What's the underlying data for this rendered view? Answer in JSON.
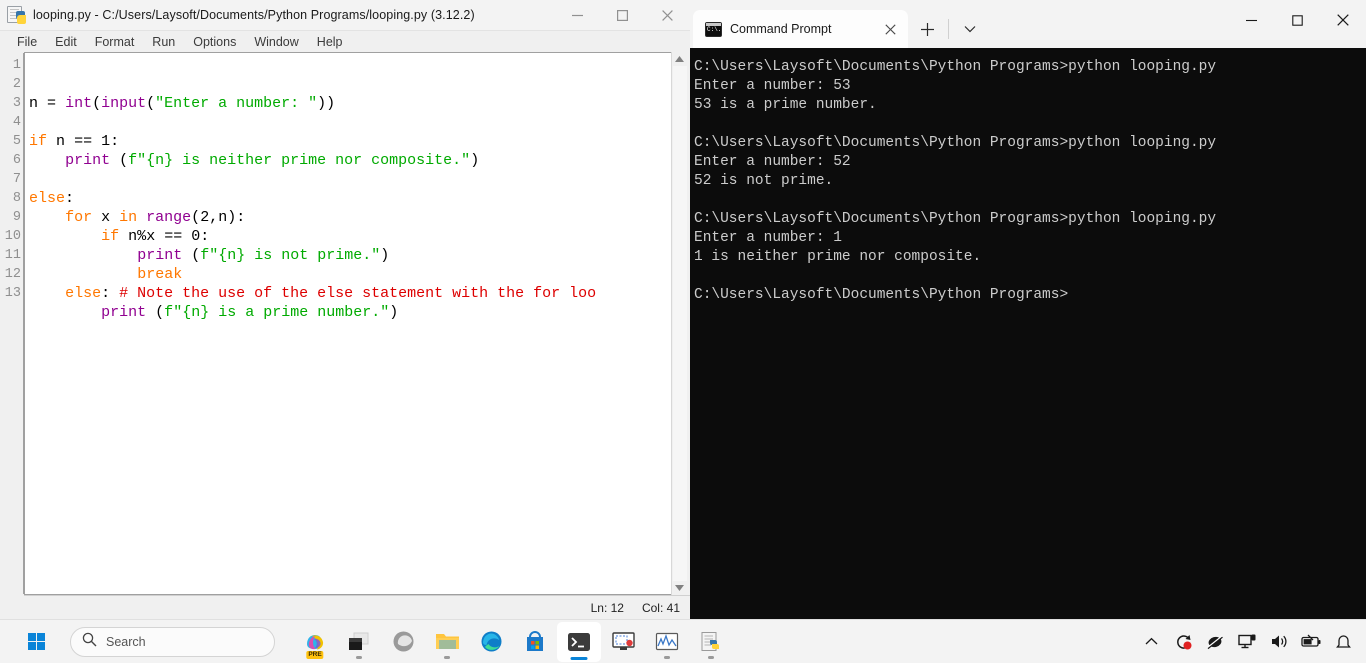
{
  "idle": {
    "window_icon": "python-file-icon",
    "title": "looping.py - C:/Users/Laysoft/Documents/Python Programs/looping.py (3.12.2)",
    "window_controls": [
      {
        "name": "minimize-button",
        "glyph": "minimize-icon"
      },
      {
        "name": "maximize-button",
        "glyph": "maximize-icon"
      },
      {
        "name": "close-button",
        "glyph": "close-icon"
      }
    ],
    "menu": [
      "File",
      "Edit",
      "Format",
      "Run",
      "Options",
      "Window",
      "Help"
    ],
    "line_numbers": [
      "1",
      "2",
      "3",
      "4",
      "5",
      "6",
      "7",
      "8",
      "9",
      "10",
      "11",
      "12",
      "13"
    ],
    "code_lines": [
      "n = int(input(\"Enter a number: \"))",
      "",
      "if n == 1:",
      "    print (f\"{n} is neither prime nor composite.\")",
      "",
      "else:",
      "    for x in range(2,n):",
      "        if n%x == 0:",
      "            print (f\"{n} is not prime.\")",
      "            break",
      "    else: # Note the use of the else statement with the for loo",
      "        print (f\"{n} is a prime number.\")",
      ""
    ],
    "status": {
      "line_label": "Ln: 12",
      "col_label": "Col: 41"
    },
    "colors": {
      "keyword": "#ff7700",
      "builtin": "#900090",
      "string": "#00aa00",
      "comment": "#dd0000",
      "plain": "#000000"
    }
  },
  "terminal": {
    "tab": {
      "icon": "command-prompt-icon",
      "title": "Command Prompt",
      "close_glyph": "close-icon"
    },
    "new_tab_glyph": "plus-icon",
    "dropdown_glyph": "chevron-down-icon",
    "window_controls": [
      {
        "name": "minimize-button",
        "glyph": "minimize-icon"
      },
      {
        "name": "maximize-button",
        "glyph": "maximize-icon"
      },
      {
        "name": "close-button",
        "glyph": "close-icon"
      }
    ],
    "lines": [
      "C:\\Users\\Laysoft\\Documents\\Python Programs>python looping.py",
      "Enter a number: 53",
      "53 is a prime number.",
      "",
      "C:\\Users\\Laysoft\\Documents\\Python Programs>python looping.py",
      "Enter a number: 52",
      "52 is not prime.",
      "",
      "C:\\Users\\Laysoft\\Documents\\Python Programs>python looping.py",
      "Enter a number: 1",
      "1 is neither prime nor composite.",
      "",
      "C:\\Users\\Laysoft\\Documents\\Python Programs>"
    ],
    "colors": {
      "background": "#0c0c0c",
      "foreground": "#cccccc"
    }
  },
  "taskbar": {
    "start_label": "start-button",
    "search": {
      "placeholder": "Search",
      "icon": "search-icon"
    },
    "apps": [
      {
        "name": "copilot-icon",
        "badge": "PRE",
        "state": "idle"
      },
      {
        "name": "task-view-icon",
        "state": "idle"
      },
      {
        "name": "browser-icon",
        "state": "idle"
      },
      {
        "name": "file-explorer-icon",
        "state": "running"
      },
      {
        "name": "microsoft-edge-icon",
        "state": "idle"
      },
      {
        "name": "microsoft-store-icon",
        "state": "idle"
      },
      {
        "name": "windows-terminal-icon",
        "state": "active"
      },
      {
        "name": "screen-recorder-icon",
        "state": "idle"
      },
      {
        "name": "performance-monitor-icon",
        "state": "running"
      },
      {
        "name": "python-idle-icon",
        "state": "running"
      }
    ],
    "tray": [
      {
        "name": "show-hidden-icons-chevron-icon"
      },
      {
        "name": "windows-update-icon",
        "badge": "red-dot"
      },
      {
        "name": "mouse-disabled-icon"
      },
      {
        "name": "network-icon"
      },
      {
        "name": "volume-icon"
      },
      {
        "name": "battery-icon"
      },
      {
        "name": "notifications-bell-icon"
      }
    ]
  }
}
